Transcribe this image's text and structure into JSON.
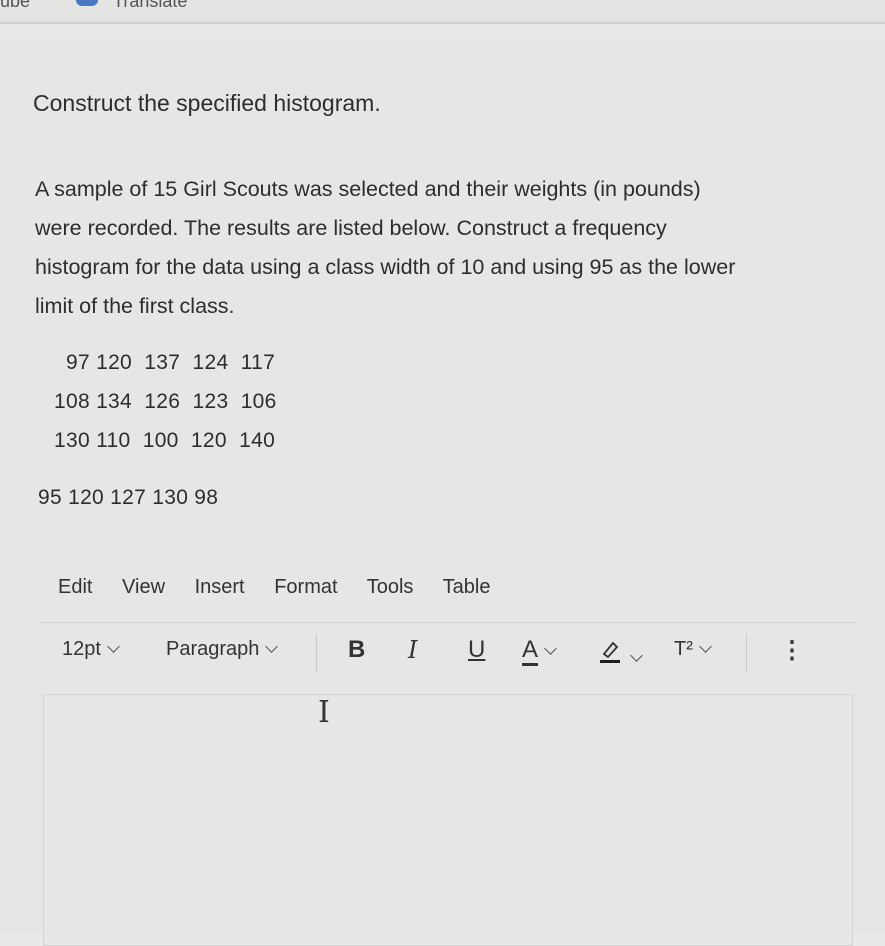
{
  "top": {
    "cut_left": "rube",
    "cut_right": "Translate"
  },
  "question": {
    "heading": "Construct the specified histogram.",
    "lines": [
      "A sample of 15 Girl Scouts was selected and their weights (in pounds)",
      "were recorded. The results are listed below. Construct a frequency",
      "histogram for the data using a class width of 10 and using 95 as the lower",
      "limit of the first class."
    ],
    "data_rows": [
      "97 120  137  124  117",
      "108 134  126  123  106",
      "130 110  100  120  140"
    ],
    "extra_row": "95 120 127 130 98"
  },
  "editor": {
    "menu": [
      "Edit",
      "View",
      "Insert",
      "Format",
      "Tools",
      "Table"
    ],
    "font_size": "12pt",
    "block_format": "Paragraph",
    "bold": "B",
    "italic": "I",
    "underline": "U",
    "text_color": "A",
    "superscript": "T²",
    "more": "⋮",
    "highlight_color": "#1f1f1f",
    "cursor_glyph": "I"
  }
}
